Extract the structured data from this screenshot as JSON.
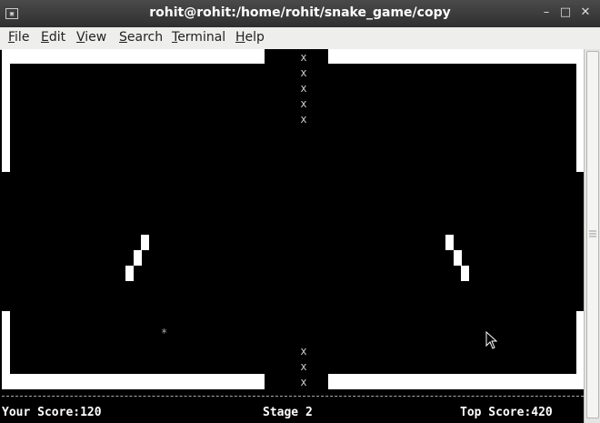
{
  "window": {
    "title": "rohit@rohit:/home/rohit/snake_game/copy",
    "app_icon": "terminal-icon",
    "buttons": [
      "minimize-icon",
      "maximize-icon",
      "close-icon"
    ],
    "glyphs": {
      "minimize": "–",
      "maximize": "□",
      "close": "✕",
      "app": "▣"
    }
  },
  "menu": {
    "items": [
      {
        "label": "File",
        "mnemonic": "F"
      },
      {
        "label": "Edit",
        "mnemonic": "E"
      },
      {
        "label": "View",
        "mnemonic": "V"
      },
      {
        "label": "Search",
        "mnemonic": "S"
      },
      {
        "label": "Terminal",
        "mnemonic": "T"
      },
      {
        "label": "Help",
        "mnemonic": "H"
      }
    ]
  },
  "game": {
    "obstacle_char": "x",
    "food_char": "*",
    "colors": {
      "background": "#000000",
      "wall": "#ffffff",
      "text": "#ffffff"
    }
  },
  "status": {
    "your_score": "Your Score:120",
    "stage": "Stage 2",
    "top_score": "Top Score:420"
  }
}
